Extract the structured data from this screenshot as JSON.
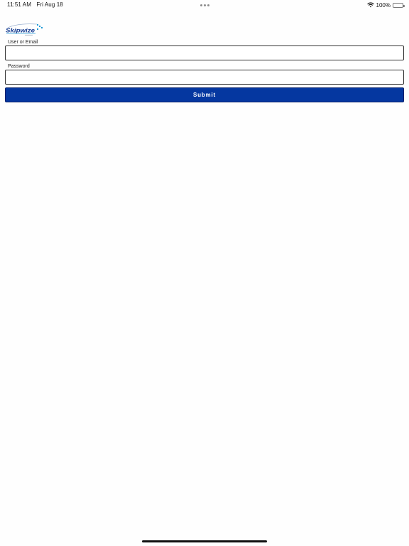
{
  "status_bar": {
    "time": "11:51 AM",
    "date": "Fri Aug 18",
    "battery_text": "100%",
    "battery_level": 1.0,
    "wifi_icon": "wifi-icon",
    "battery_icon": "battery-icon"
  },
  "logo": {
    "text": "Skipwize",
    "accent_color": "#1f9ad6",
    "brand_color": "#153b91"
  },
  "form": {
    "user_label": "User or Email",
    "user_value": "",
    "password_label": "Password",
    "password_value": "",
    "submit_label": "Submit"
  },
  "colors": {
    "submit_background": "#0537a0",
    "page_background": "#fefefe"
  }
}
